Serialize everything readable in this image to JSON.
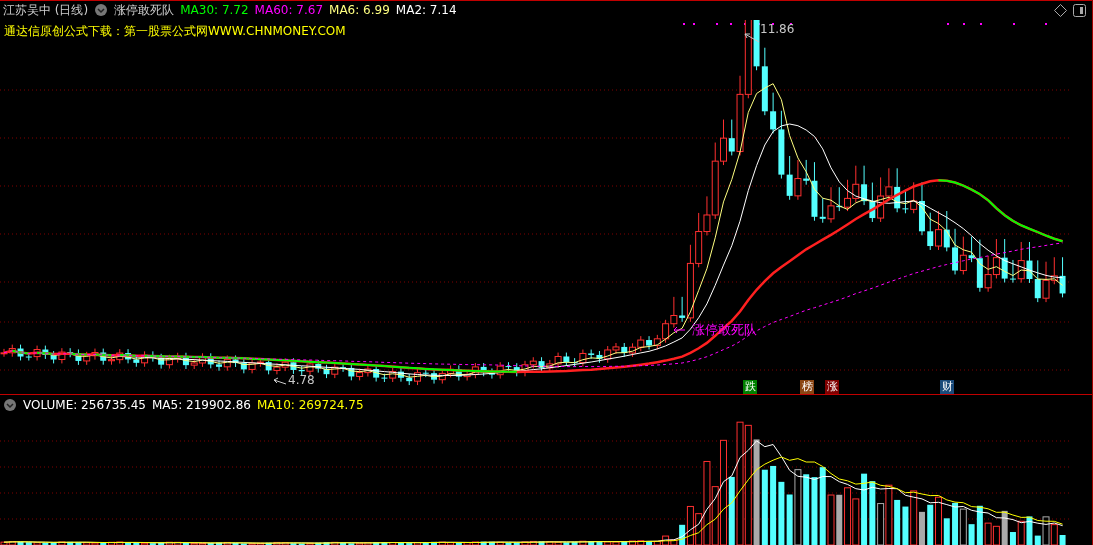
{
  "header": {
    "security": "江苏吴中 (日线)",
    "indicator": "涨停敢死队",
    "readings": [
      {
        "text": "MA30: 7.72",
        "color": "#00ff00"
      },
      {
        "text": "MA60: 7.67",
        "color": "#ff00ff"
      },
      {
        "text": "MA6: 6.99",
        "color": "#ffff80"
      },
      {
        "text": "MA2: 7.14",
        "color": "#ffffff"
      }
    ]
  },
  "info_line": "通达信原创公式下载：第一股票公式网WWW.CHNMONEY.COM",
  "price_labels": {
    "high": "11.86",
    "low": "4.78"
  },
  "signal_label": "涨停敢死队",
  "event_badges": [
    {
      "text": "跌",
      "color": "#008000"
    },
    {
      "text": "榜",
      "color": "#8b4513"
    },
    {
      "text": "涨",
      "color": "#800000"
    },
    {
      "text": "财",
      "color": "#1a4a7a"
    }
  ],
  "volume_header": {
    "readings": [
      {
        "text": "VOLUME: 256735.45",
        "color": "#ffffff"
      },
      {
        "text": "MA5: 219902.86",
        "color": "#ffffff"
      },
      {
        "text": "MA10: 269724.75",
        "color": "#ffff00"
      }
    ]
  }
}
